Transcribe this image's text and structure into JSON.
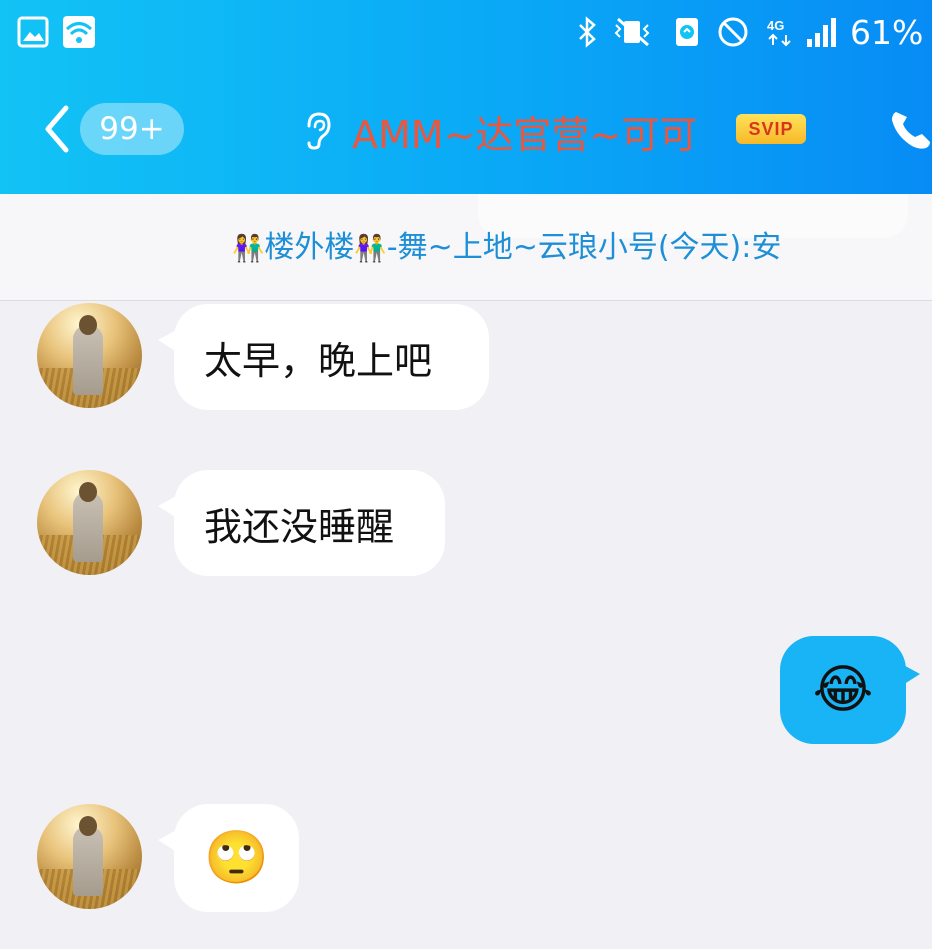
{
  "status_bar": {
    "battery": "61%",
    "icons": [
      "image-icon",
      "wifi-icon",
      "bluetooth-icon",
      "mute-vibrate-icon",
      "data-saver-icon",
      "do-not-disturb-icon",
      "4g-icon",
      "signal-icon",
      "battery-icon"
    ]
  },
  "header": {
    "back_icon": "chevron-left-icon",
    "unread_badge": "99+",
    "ear_icon": "ear-icon",
    "chat_title": "AMM~达官营~可可",
    "vip_badge": "SVIP",
    "call_icon": "phone-icon",
    "gradient": [
      "#12c3f5",
      "#078cf5"
    ]
  },
  "notice": {
    "emoji_left": "👫",
    "emoji_mid": "👫",
    "group": "楼外楼",
    "text": "-舞~上地~云琅小号(今天):安"
  },
  "messages": [
    {
      "side": "left",
      "text": "太早，晚上吧"
    },
    {
      "side": "left",
      "text": "我还没睡醒"
    },
    {
      "side": "right",
      "emoji": "😂"
    },
    {
      "side": "left",
      "emoji": "🙄"
    }
  ],
  "colors": {
    "title": "#e8573f",
    "notice_text": "#1e8fd6",
    "own_bubble": "#18b4f5",
    "background": "#f0f0f5"
  }
}
